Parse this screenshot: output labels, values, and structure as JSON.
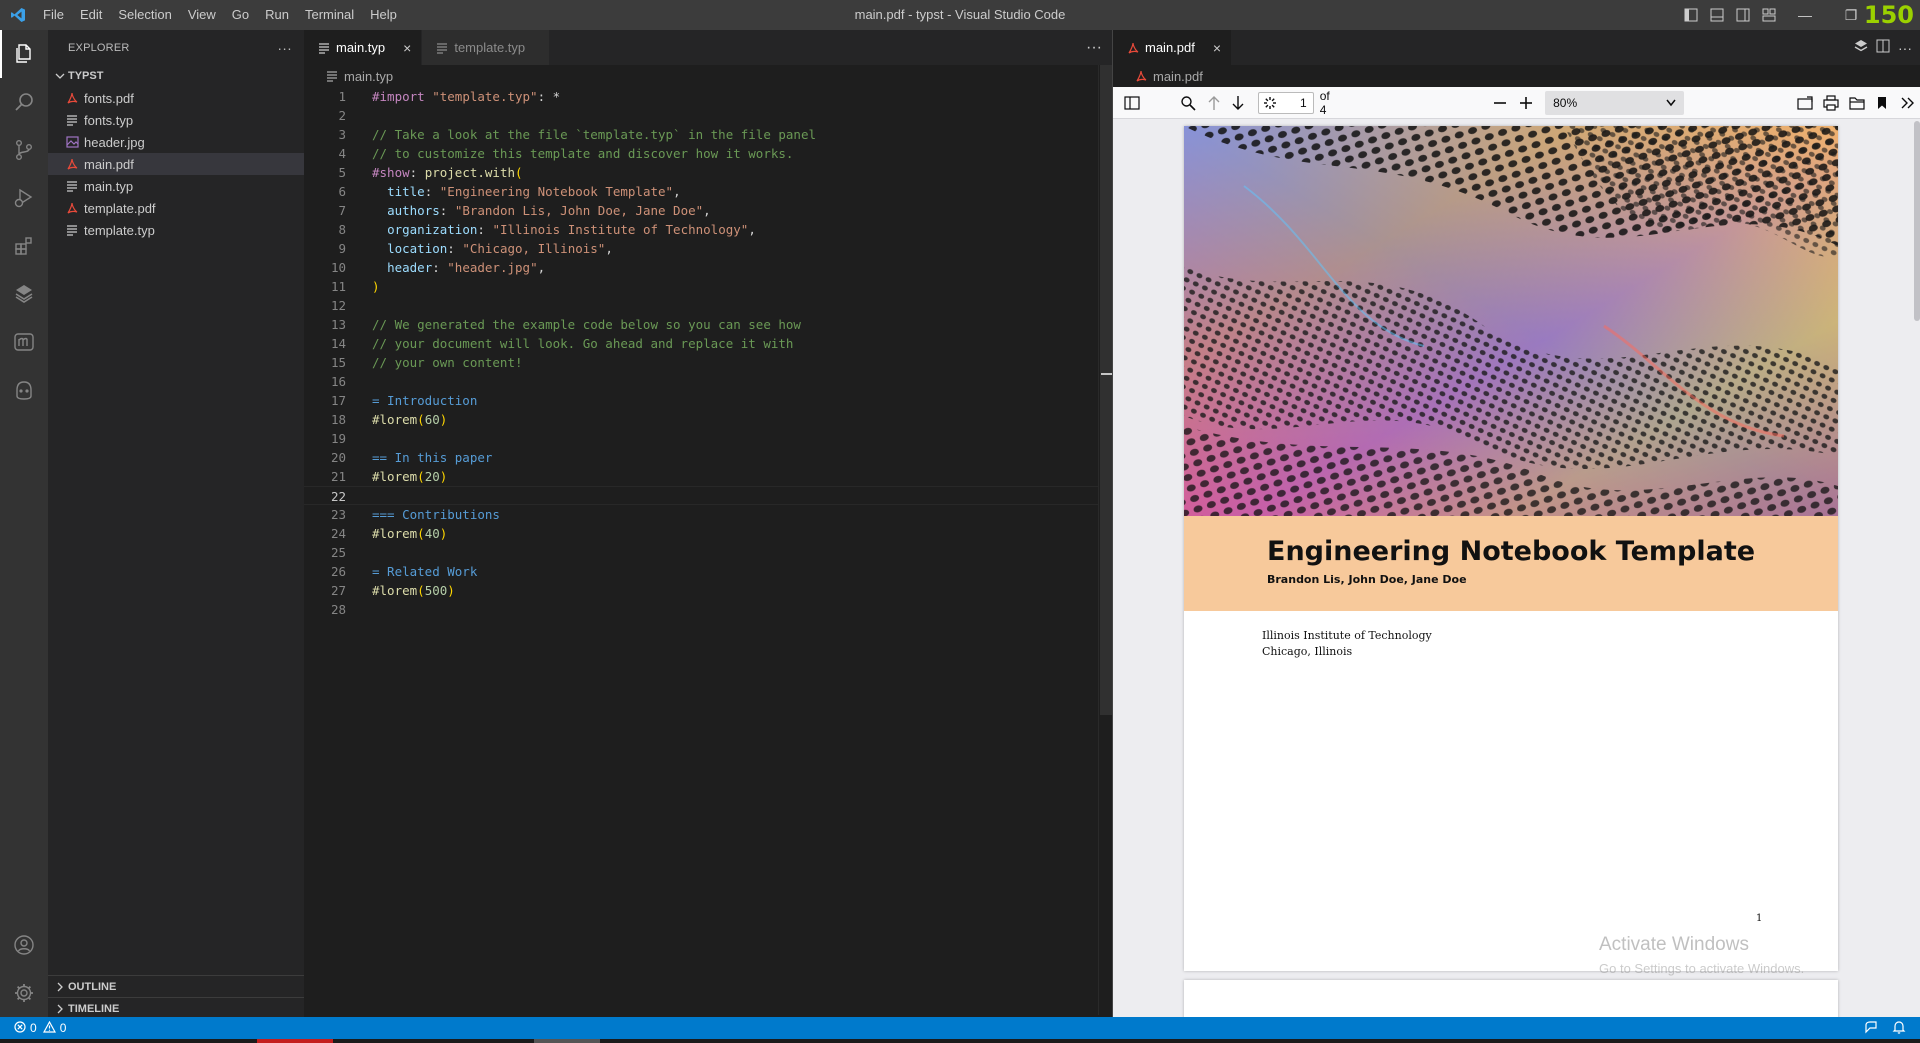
{
  "window": {
    "title": "main.pdf - typst - Visual Studio Code",
    "menu": [
      "File",
      "Edit",
      "Selection",
      "View",
      "Go",
      "Run",
      "Terminal",
      "Help"
    ],
    "fps_counter": "150"
  },
  "activity_bar": {
    "items": [
      "explorer-icon",
      "search-icon",
      "source-control-icon",
      "run-debug-icon",
      "extensions-icon",
      "gitlens-icon",
      "typst-icon",
      "copilot-icon"
    ],
    "bottom": [
      "account-icon",
      "settings-gear-icon"
    ]
  },
  "sidebar": {
    "header": "EXPLORER",
    "more": "···",
    "folder": "TYPST",
    "files": [
      {
        "name": "fonts.pdf",
        "icon": "pdf-icon"
      },
      {
        "name": "fonts.typ",
        "icon": "text-file-icon"
      },
      {
        "name": "header.jpg",
        "icon": "image-icon"
      },
      {
        "name": "main.pdf",
        "icon": "pdf-icon",
        "selected": true
      },
      {
        "name": "main.typ",
        "icon": "text-file-icon"
      },
      {
        "name": "template.pdf",
        "icon": "pdf-icon"
      },
      {
        "name": "template.typ",
        "icon": "text-file-icon"
      }
    ],
    "outline": "OUTLINE",
    "timeline": "TIMELINE"
  },
  "editor": {
    "tabs": [
      {
        "label": "main.typ",
        "active": true,
        "close": "×"
      },
      {
        "label": "template.typ",
        "active": false
      }
    ],
    "more": "···",
    "breadcrumb": "main.typ",
    "current_line": 22,
    "lines": [
      [
        {
          "t": "#import",
          "c": "t-kw"
        },
        {
          "t": " ",
          "c": "t-plain"
        },
        {
          "t": "\"template.typ\"",
          "c": "t-str"
        },
        {
          "t": ": *",
          "c": "t-plain"
        }
      ],
      [],
      [
        {
          "t": "// Take a look at the file `template.typ` in the file panel",
          "c": "t-com"
        }
      ],
      [
        {
          "t": "// to customize this template and discover how it works.",
          "c": "t-com"
        }
      ],
      [
        {
          "t": "#show",
          "c": "t-kw"
        },
        {
          "t": ": ",
          "c": "t-plain"
        },
        {
          "t": "project.with",
          "c": "t-fn"
        },
        {
          "t": "(",
          "c": "t-brk"
        }
      ],
      [
        {
          "t": "  ",
          "c": "t-plain"
        },
        {
          "t": "title",
          "c": "t-var"
        },
        {
          "t": ": ",
          "c": "t-plain"
        },
        {
          "t": "\"Engineering Notebook Template\"",
          "c": "t-str"
        },
        {
          "t": ",",
          "c": "t-plain"
        }
      ],
      [
        {
          "t": "  ",
          "c": "t-plain"
        },
        {
          "t": "authors",
          "c": "t-var"
        },
        {
          "t": ": ",
          "c": "t-plain"
        },
        {
          "t": "\"Brandon Lis, John Doe, Jane Doe\"",
          "c": "t-str"
        },
        {
          "t": ",",
          "c": "t-plain"
        }
      ],
      [
        {
          "t": "  ",
          "c": "t-plain"
        },
        {
          "t": "organization",
          "c": "t-var"
        },
        {
          "t": ": ",
          "c": "t-plain"
        },
        {
          "t": "\"Illinois Institute of Technology\"",
          "c": "t-str"
        },
        {
          "t": ",",
          "c": "t-plain"
        }
      ],
      [
        {
          "t": "  ",
          "c": "t-plain"
        },
        {
          "t": "location",
          "c": "t-var"
        },
        {
          "t": ": ",
          "c": "t-plain"
        },
        {
          "t": "\"Chicago, Illinois\"",
          "c": "t-str"
        },
        {
          "t": ",",
          "c": "t-plain"
        }
      ],
      [
        {
          "t": "  ",
          "c": "t-plain"
        },
        {
          "t": "header",
          "c": "t-var"
        },
        {
          "t": ": ",
          "c": "t-plain"
        },
        {
          "t": "\"header.jpg\"",
          "c": "t-str"
        },
        {
          "t": ",",
          "c": "t-plain"
        }
      ],
      [
        {
          "t": ")",
          "c": "t-brk"
        }
      ],
      [],
      [
        {
          "t": "// We generated the example code below so you can see how",
          "c": "t-com"
        }
      ],
      [
        {
          "t": "// your document will look. Go ahead and replace it with",
          "c": "t-com"
        }
      ],
      [
        {
          "t": "// your own content!",
          "c": "t-com"
        }
      ],
      [],
      [
        {
          "t": "= Introduction",
          "c": "t-head"
        }
      ],
      [
        {
          "t": "#lorem",
          "c": "t-fn"
        },
        {
          "t": "(",
          "c": "t-brk"
        },
        {
          "t": "60",
          "c": "t-num"
        },
        {
          "t": ")",
          "c": "t-brk"
        }
      ],
      [],
      [
        {
          "t": "== In this paper",
          "c": "t-head"
        }
      ],
      [
        {
          "t": "#lorem",
          "c": "t-fn"
        },
        {
          "t": "(",
          "c": "t-brk"
        },
        {
          "t": "20",
          "c": "t-num"
        },
        {
          "t": ")",
          "c": "t-brk"
        }
      ],
      [],
      [
        {
          "t": "=== Contributions",
          "c": "t-head"
        }
      ],
      [
        {
          "t": "#lorem",
          "c": "t-fn"
        },
        {
          "t": "(",
          "c": "t-brk"
        },
        {
          "t": "40",
          "c": "t-num"
        },
        {
          "t": ")",
          "c": "t-brk"
        }
      ],
      [],
      [
        {
          "t": "= Related Work",
          "c": "t-head"
        }
      ],
      [
        {
          "t": "#lorem",
          "c": "t-fn"
        },
        {
          "t": "(",
          "c": "t-brk"
        },
        {
          "t": "500",
          "c": "t-num"
        },
        {
          "t": ")",
          "c": "t-brk"
        }
      ],
      []
    ]
  },
  "pdf_viewer": {
    "tab": {
      "label": "main.pdf",
      "close": "×"
    },
    "breadcrumb": "main.pdf",
    "page_input": "1",
    "page_count": "of 4",
    "zoom": "80%",
    "document": {
      "title": "Engineering Notebook Template",
      "authors": "Brandon Lis, John Doe, Jane Doe",
      "organization": "Illinois Institute of Technology",
      "location": "Chicago, Illinois",
      "page_number": "1"
    },
    "watermark": {
      "line1": "Activate Windows",
      "line2": "Go to Settings to activate Windows."
    }
  },
  "status_bar": {
    "errors": "0",
    "warnings": "0"
  },
  "colors": {
    "accent": "#007acc",
    "title_band": "#f7c99b",
    "fps": "#9bd100"
  }
}
